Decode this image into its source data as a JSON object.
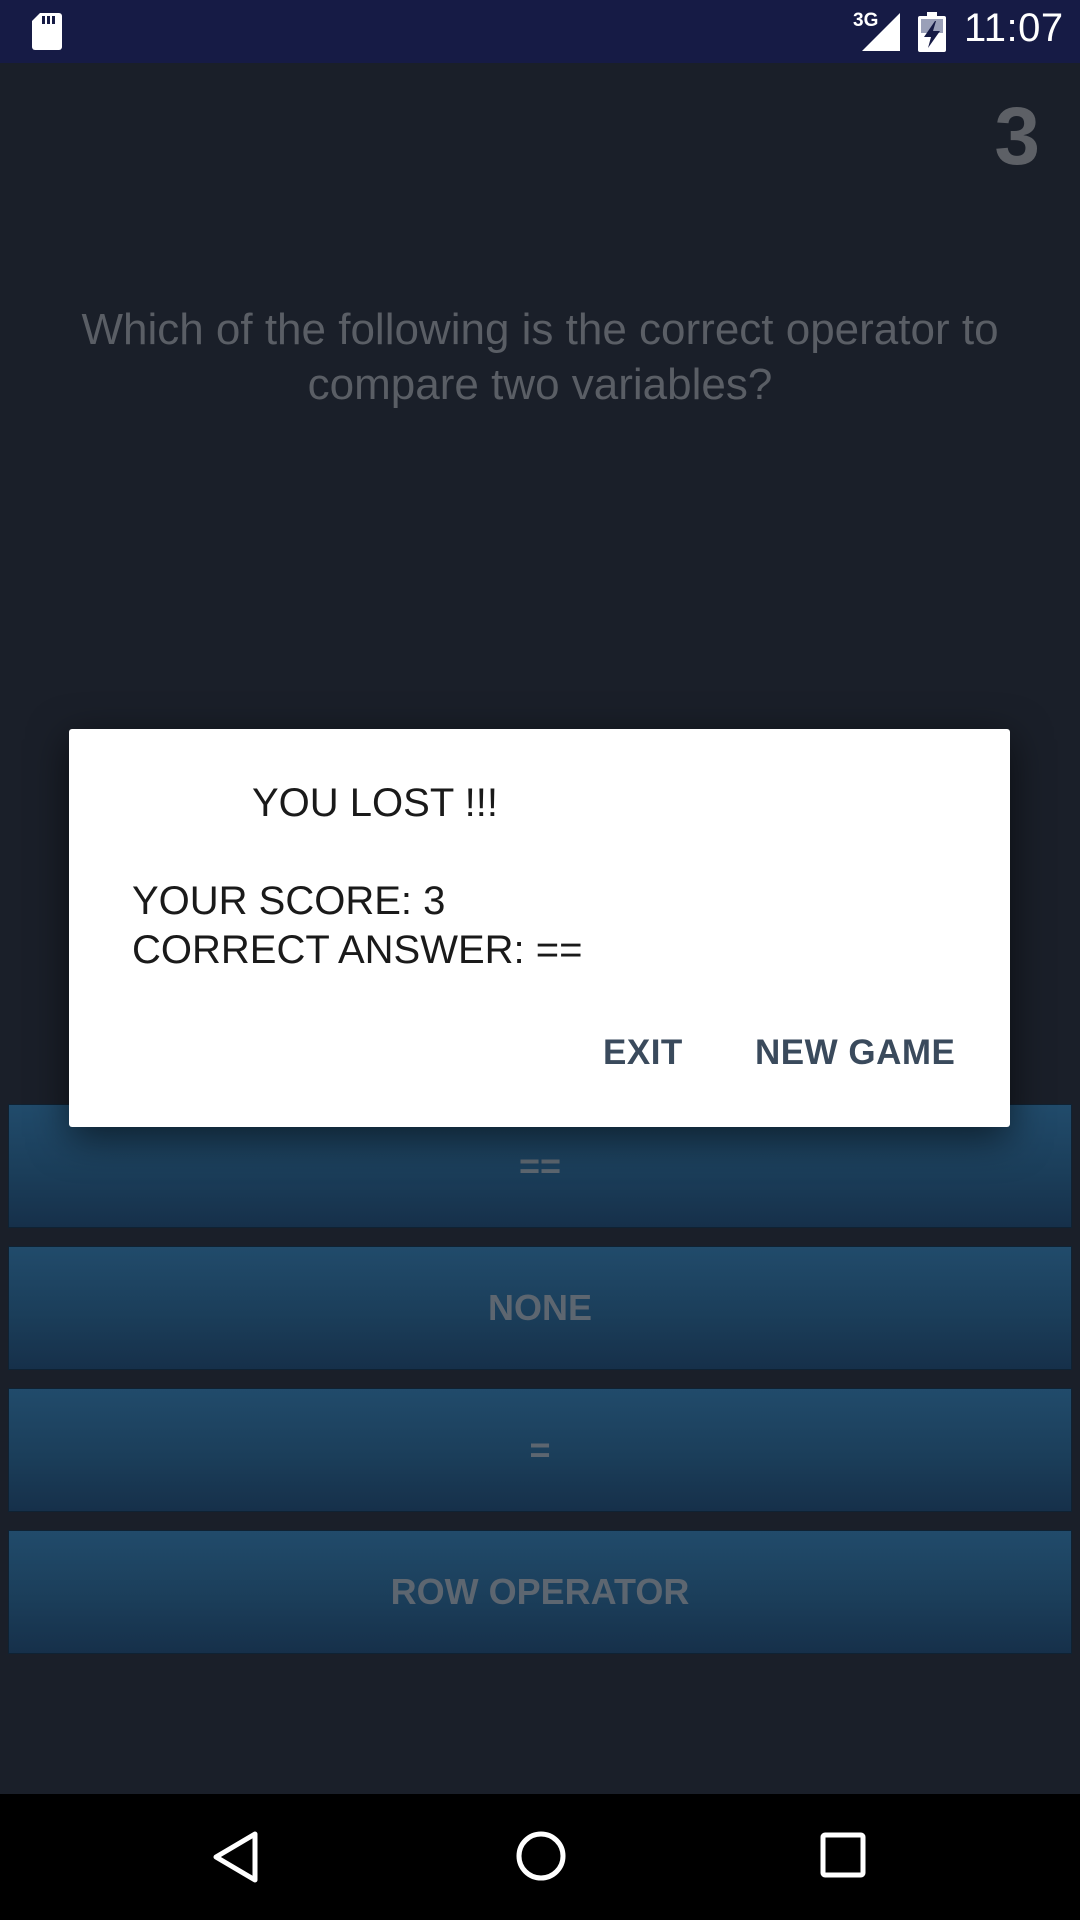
{
  "status_bar": {
    "network_type": "3G",
    "time": "11:07",
    "icons": [
      "sd-card-icon",
      "signal-icon",
      "battery-charging-icon"
    ]
  },
  "game": {
    "score": "3",
    "question": "Which of the following is the correct operator to compare two variables?",
    "answers": [
      "==",
      "NONE",
      "=",
      "ROW OPERATOR"
    ]
  },
  "dialog": {
    "title": "YOU LOST !!!",
    "score_line": "YOUR SCORE: 3",
    "answer_line": "CORRECT ANSWER: ==",
    "exit_label": "EXIT",
    "new_game_label": "NEW GAME"
  },
  "nav_bar": {
    "icons": [
      "back-icon",
      "home-icon",
      "recents-icon"
    ]
  },
  "colors": {
    "status_bar_bg": "#161b45",
    "screen_bg": "#1a1f29",
    "answer_button": "#1e4463",
    "dialog_bg": "#ffffff",
    "dialog_action_text": "#3a4a5c"
  }
}
